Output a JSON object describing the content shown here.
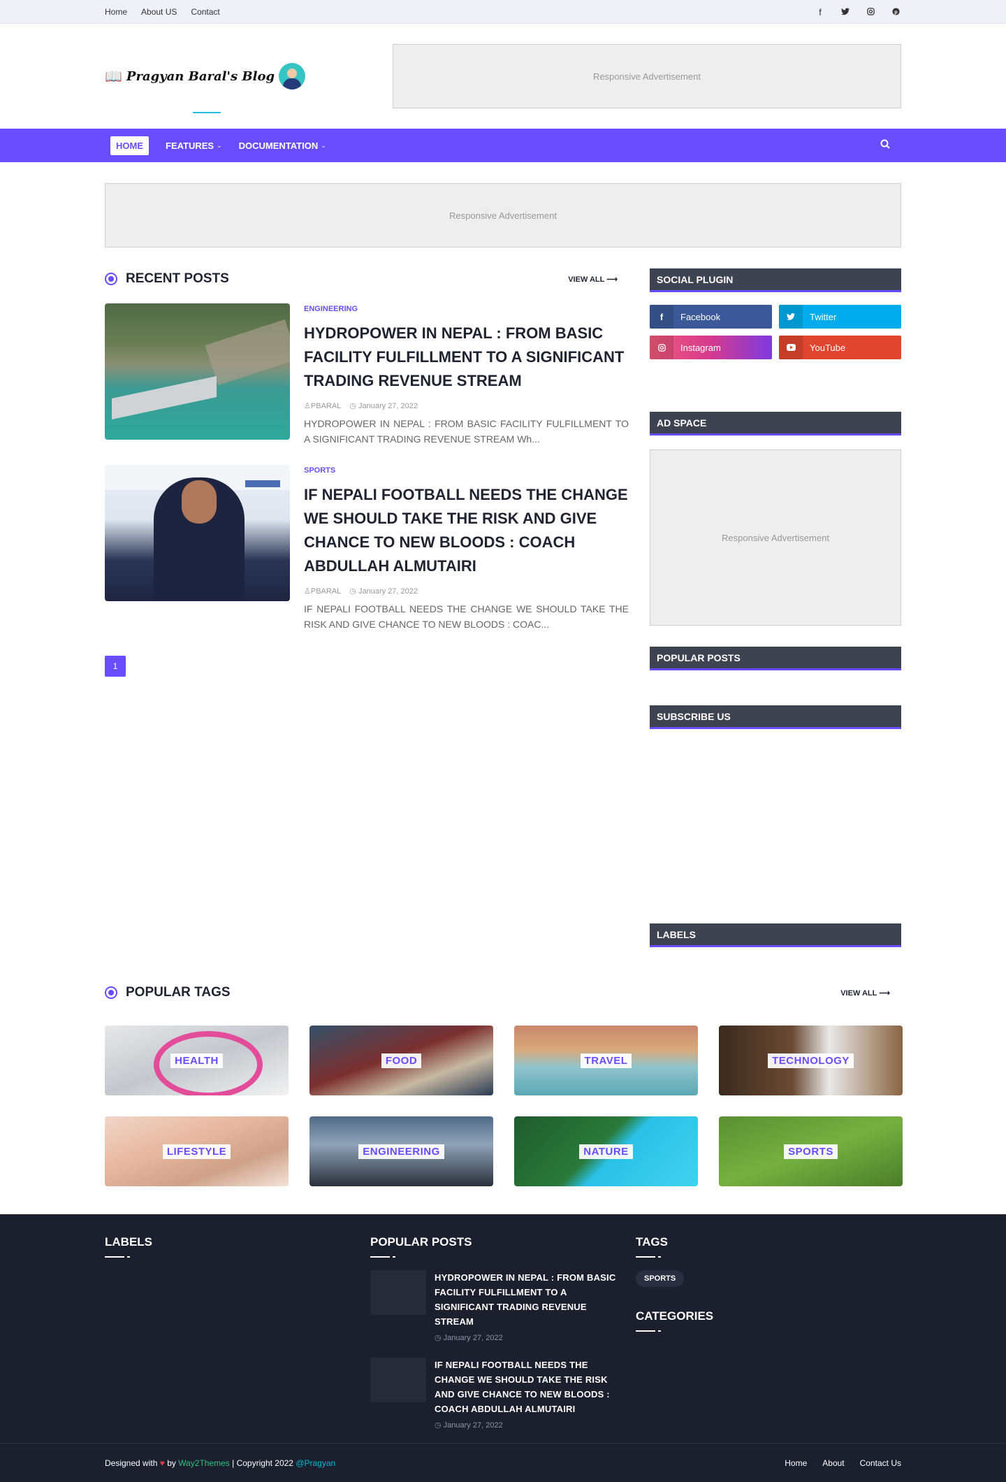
{
  "topbar": {
    "links": [
      "Home",
      "About US",
      "Contact"
    ],
    "social_icons": [
      "facebook-icon",
      "twitter-icon",
      "instagram-icon",
      "pinterest-icon"
    ]
  },
  "header": {
    "logo_text": "Pragyan Baral's Blog",
    "ad_text": "Responsive Advertisement"
  },
  "nav": {
    "items": [
      "HOME",
      "FEATURES",
      "DOCUMENTATION"
    ],
    "active": "HOME"
  },
  "wide_ad": {
    "text": "Responsive Advertisement"
  },
  "recent": {
    "title": "RECENT POSTS",
    "view_all": "VIEW ALL",
    "posts": [
      {
        "category": "ENGINEERING",
        "title": "HYDROPOWER IN NEPAL : FROM BASIC FACILITY FULFILLMENT TO A SIGNIFICANT TRADING REVENUE STREAM",
        "author": "PBARAL",
        "date": "January 27, 2022",
        "excerpt": "HYDROPOWER IN NEPAL : FROM BASIC FACILITY FULFILLMENT TO A SIGNIFICANT TRADING REVENUE STREAM Wh..."
      },
      {
        "category": "SPORTS",
        "title": "IF NEPALI FOOTBALL NEEDS THE CHANGE WE SHOULD TAKE THE RISK AND GIVE CHANCE TO NEW BLOODS : COACH ABDULLAH ALMUTAIRI",
        "author": "PBARAL",
        "date": "January 27, 2022",
        "excerpt": "IF NEPALI FOOTBALL NEEDS THE CHANGE WE SHOULD TAKE THE RISK AND GIVE CHANCE TO NEW BLOODS : COAC..."
      }
    ],
    "page": "1"
  },
  "sidebar": {
    "social_title": "SOCIAL PLUGIN",
    "social": [
      "Facebook",
      "Twitter",
      "Instagram",
      "YouTube"
    ],
    "ad_title": "AD SPACE",
    "ad_text": "Responsive Advertisement",
    "popular_title": "POPULAR POSTS",
    "subscribe_title": "SUBSCRIBE US",
    "labels_title": "LABELS"
  },
  "tags": {
    "title": "POPULAR TAGS",
    "view_all": "VIEW ALL",
    "items": [
      "HEALTH",
      "FOOD",
      "TRAVEL",
      "TECHNOLOGY",
      "LIFESTYLE",
      "ENGINEERING",
      "NATURE",
      "SPORTS"
    ]
  },
  "footer": {
    "labels_title": "LABELS",
    "popular_title": "POPULAR POSTS",
    "posts": [
      {
        "title": "HYDROPOWER IN NEPAL : FROM BASIC FACILITY FULFILLMENT TO A SIGNIFICANT TRADING REVENUE STREAM",
        "date": "January 27, 2022"
      },
      {
        "title": "IF NEPALI FOOTBALL NEEDS THE CHANGE WE SHOULD TAKE THE RISK AND GIVE CHANCE TO NEW BLOODS : COACH ABDULLAH ALMUTAIRI",
        "date": "January 27, 2022"
      }
    ],
    "tags_title": "TAGS",
    "tag": "SPORTS",
    "categories_title": "CATEGORIES",
    "credit": {
      "designed": "Designed with",
      "by": "by",
      "theme": "Way2Themes",
      "copyright": "| Copyright 2022",
      "author": "@Pragyan"
    },
    "links": [
      "Home",
      "About",
      "Contact Us"
    ]
  },
  "colors": {
    "accent": "#6a4cff",
    "widget_header": "#3d4351",
    "footer_bg": "#1b1f2e"
  }
}
